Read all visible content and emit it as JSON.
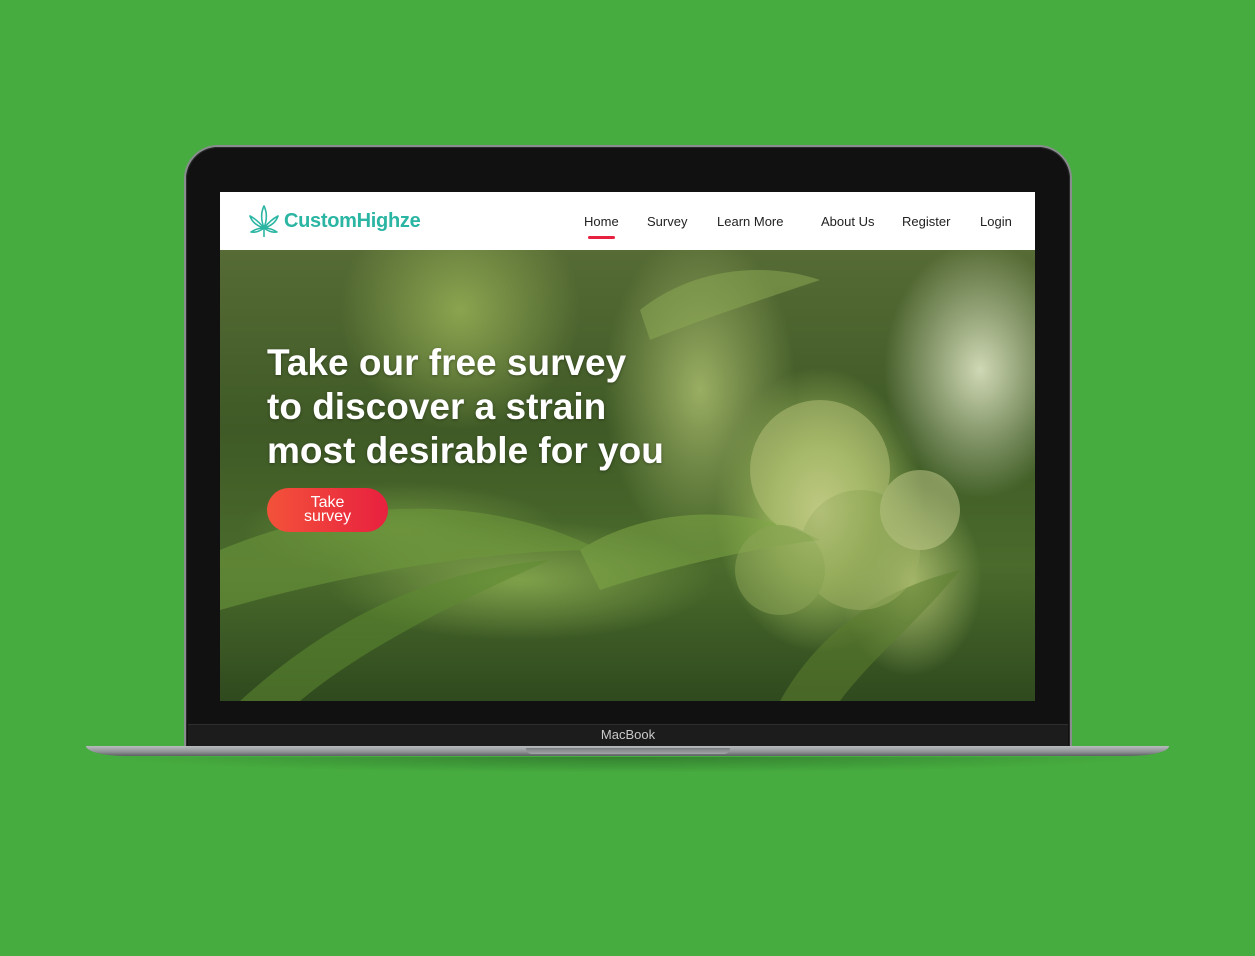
{
  "device": {
    "label": "MacBook"
  },
  "brand": {
    "name": "CustomHighze",
    "icon": "cannabis-leaf-icon",
    "color": "#2bb5a3"
  },
  "nav": {
    "items": [
      {
        "label": "Home",
        "active": true
      },
      {
        "label": "Survey"
      },
      {
        "label": "Learn More"
      },
      {
        "label": "About Us"
      },
      {
        "label": "Register"
      },
      {
        "label": "Login"
      }
    ],
    "active_color": "#e8203f"
  },
  "hero": {
    "title_lines": [
      "Take our free survey",
      "to discover a strain",
      "most desirable for you"
    ],
    "cta": {
      "line1": "Take",
      "line2": "survey"
    }
  },
  "colors": {
    "background": "#46ac3f",
    "accent": "#e8203f"
  }
}
